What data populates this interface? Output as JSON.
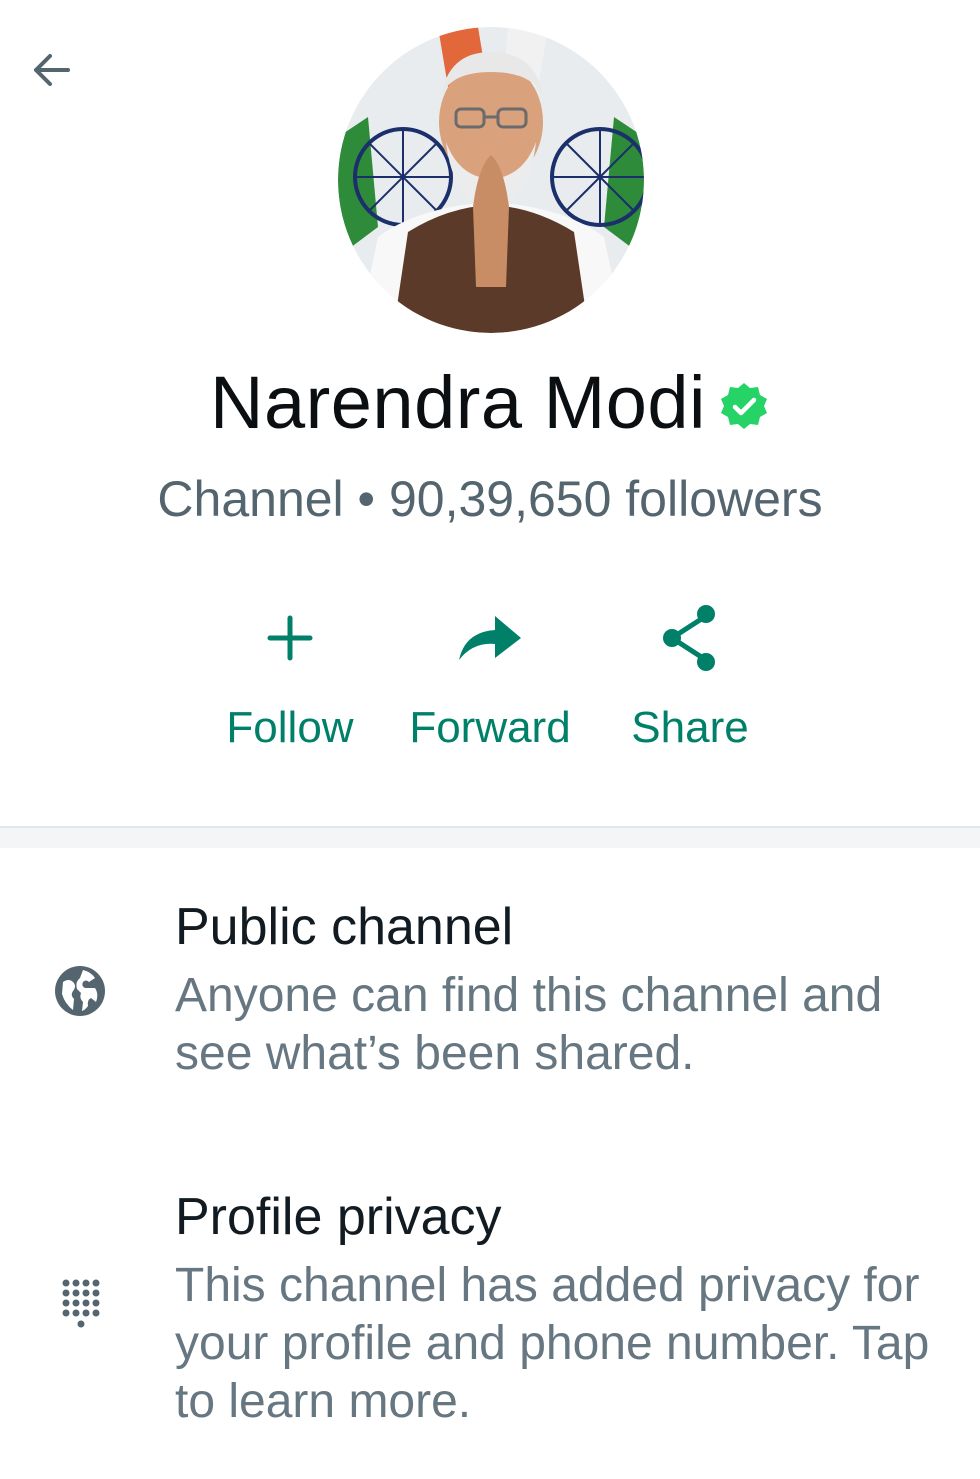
{
  "header": {
    "back_icon": "arrow-left-icon"
  },
  "profile": {
    "name": "Narendra Modi",
    "verified_icon": "verified-badge-icon",
    "subtitle": "Channel • 90,39,650 followers"
  },
  "actions": [
    {
      "label": "Follow",
      "icon": "plus-icon"
    },
    {
      "label": "Forward",
      "icon": "forward-arrow-icon"
    },
    {
      "label": "Share",
      "icon": "share-icon"
    }
  ],
  "info": {
    "public": {
      "title": "Public channel",
      "description": "Anyone can find this channel and see what’s been shared.",
      "icon": "globe-icon"
    },
    "privacy": {
      "title": "Profile privacy",
      "description": "This channel has added privacy for your profile and phone number. Tap to learn more.",
      "icon": "dots-grid-icon"
    }
  },
  "colors": {
    "accent": "#008069",
    "verified": "#25d366",
    "secondary_text": "#667781",
    "icon_gray": "#54656f"
  }
}
